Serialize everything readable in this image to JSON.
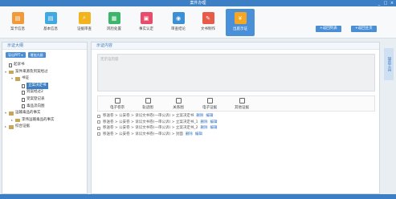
{
  "window": {
    "title": "案件办理",
    "controls": [
      "_",
      "□",
      "×"
    ]
  },
  "toolbar": {
    "items": [
      {
        "label": "案卡信息",
        "color": "#f09a3a",
        "glyph": "▤"
      },
      {
        "label": "基本信息",
        "color": "#3fa9e0",
        "glyph": "▤"
      },
      {
        "label": "证据审查",
        "color": "#f2b31c",
        "glyph": "⌕"
      },
      {
        "label": "风险处置",
        "color": "#3bb66a",
        "glyph": "▦"
      },
      {
        "label": "事实认定",
        "color": "#e84c6a",
        "glyph": "▣"
      },
      {
        "label": "审查结论",
        "color": "#3b8fd4",
        "glyph": "◉"
      },
      {
        "label": "文书制作",
        "color": "#e85a4a",
        "glyph": "✎"
      },
      {
        "label": "出庭示证",
        "color": "#f5a623",
        "glyph": "¥"
      }
    ],
    "active_index": 7,
    "right_buttons": [
      "+返回列表",
      "+返回主页"
    ]
  },
  "left_panel": {
    "title": "示证大纲",
    "buttons": [
      "导出PPT ▾",
      "增加大纲"
    ],
    "tree": [
      {
        "label": "起诉书",
        "level": 0,
        "type": "doc"
      },
      {
        "label": "案件来源及到案经过",
        "level": 0,
        "type": "folder",
        "toggle": "▾"
      },
      {
        "label": "书证",
        "level": 1,
        "type": "folder",
        "toggle": "▾"
      },
      {
        "label": "立案决定书",
        "level": 2,
        "type": "doc",
        "selected": true
      },
      {
        "label": "到案经过2",
        "level": 2,
        "type": "doc"
      },
      {
        "label": "受案登记表",
        "level": 2,
        "type": "doc"
      },
      {
        "label": "毒品流向图",
        "level": 2,
        "type": "doc"
      },
      {
        "label": "运输毒品的事实",
        "level": 0,
        "type": "folder",
        "toggle": "▾"
      },
      {
        "label": "李伟运输毒品的事实",
        "level": 1,
        "type": "folder",
        "toggle": "▸"
      },
      {
        "label": "综合证据",
        "level": 0,
        "type": "folder",
        "toggle": "▸"
      }
    ]
  },
  "right_panel": {
    "title": "示证内容",
    "textarea_placeholder": "无示证内容",
    "attach_items": [
      "电子卷宗",
      "轨迹图",
      "关系图",
      "电子证据",
      "其他证据"
    ],
    "evidence_rows": [
      {
        "path": "移送卷 > 公安卷 > 诉讼文书卷(一审公诉) > 立案决定书",
        "actions": [
          "删除",
          "编辑"
        ]
      },
      {
        "path": "移送卷 > 公安卷 > 诉讼文书卷(一审公诉) > 立案决定书_1",
        "actions": [
          "删除",
          "编辑"
        ]
      },
      {
        "path": "移送卷 > 公安卷 > 诉讼文书卷(一审公诉) > 立案决定书_2",
        "actions": [
          "删除",
          "编辑"
        ]
      },
      {
        "path": "移送卷 > 公安卷 > 诉讼文书卷(一审公诉) > 封面",
        "actions": [
          "删除",
          "编辑"
        ]
      }
    ]
  },
  "side_tab": {
    "label": "辅助工具"
  }
}
